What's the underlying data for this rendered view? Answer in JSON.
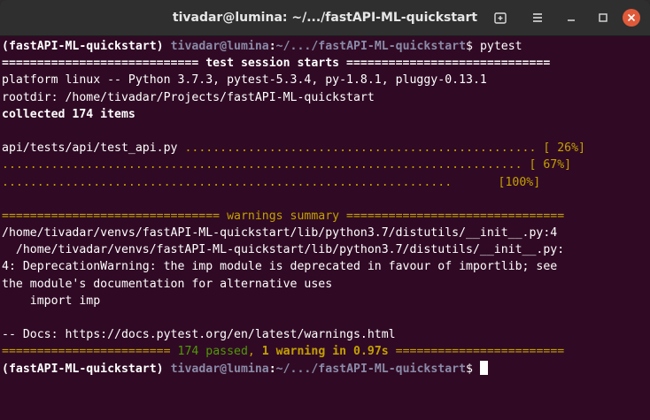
{
  "window": {
    "title": "tivadar@lumina: ~/.../fastAPI-ML-quickstart",
    "buttons": [
      "new-tab",
      "menu",
      "minimize",
      "maximize",
      "close"
    ]
  },
  "terminal": {
    "prompt1": {
      "env": "(fastAPI-ML-quickstart) ",
      "user": "tivadar@lumina",
      "sep": ":",
      "path": "~/.../fastAPI-ML-quickstart",
      "dollar": "$ ",
      "command": "pytest"
    },
    "header_sep": "============================ test session starts =============================",
    "platform": "platform linux -- Python 3.7.3, pytest-5.3.4, py-1.8.1, pluggy-0.13.1",
    "rootdir": "rootdir: /home/tivadar/Projects/fastAPI-ML-quickstart",
    "collected": "collected 174 items",
    "blank": "",
    "test1": {
      "name": "api/tests/api/test_api.py ",
      "dots": "..................................................",
      "pct": " [ 26%]"
    },
    "test2": {
      "dots": "..........................................................................",
      "pct": " [ 67%]"
    },
    "test3": {
      "dots": "................................................................",
      "pct": "[100%]"
    },
    "warnings_sep": "=============================== warnings summary ===============================",
    "warn1": "/home/tivadar/venvs/fastAPI-ML-quickstart/lib/python3.7/distutils/__init__.py:4",
    "warn2": "  /home/tivadar/venvs/fastAPI-ML-quickstart/lib/python3.7/distutils/__init__.py:",
    "warn3": "4: DeprecationWarning: the imp module is deprecated in favour of importlib; see",
    "warn4": "the module's documentation for alternative uses",
    "warn5": "    import imp",
    "docs": "-- Docs: https://docs.pytest.org/en/latest/warnings.html",
    "summary": {
      "left": "======================== ",
      "passed": "174 passed",
      "comma": ", ",
      "warning": "1 warning in 0.97s",
      "right": " ========================"
    },
    "prompt2": {
      "env": "(fastAPI-ML-quickstart) ",
      "user": "tivadar@lumina",
      "sep": ":",
      "path": "~/.../fastAPI-ML-quickstart",
      "dollar": "$ "
    }
  },
  "colors": {
    "background": "#300a24",
    "titlebar": "#2f2f2f",
    "text": "#d3d7cf",
    "yellow": "#c4a000",
    "green": "#4e9a06"
  }
}
